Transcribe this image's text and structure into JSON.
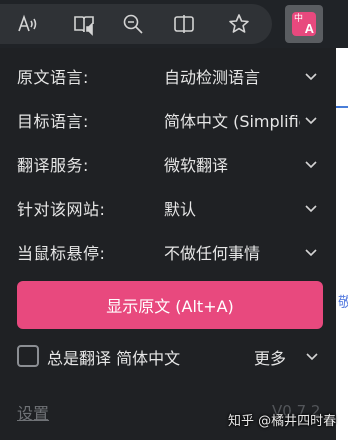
{
  "toolbar": {
    "buttons": [
      {
        "icon": "read-aloud-icon"
      },
      {
        "icon": "immersive-reader-icon"
      },
      {
        "icon": "zoom-out-icon"
      },
      {
        "icon": "split-screen-icon"
      },
      {
        "icon": "favorite-star-icon"
      }
    ],
    "extension": {
      "icon": "translate-extension-icon",
      "zh": "中",
      "en": "A",
      "color": "#e8497e"
    }
  },
  "popup": {
    "rows": [
      {
        "label": "原文语言:",
        "value": "自动检测语言"
      },
      {
        "label": "目标语言:",
        "value": "简体中文 (Simplified Chinese)"
      },
      {
        "label": "翻译服务:",
        "value": "微软翻译"
      },
      {
        "label": "针对该网站:",
        "value": "默认"
      },
      {
        "label": "当鼠标悬停:",
        "value": "不做任何事情"
      }
    ],
    "main_button": "显示原文 (Alt+A)",
    "always_translate": {
      "checked": false,
      "label": "总是翻译 简体中文"
    },
    "more": "更多",
    "settings": "设置",
    "version": "V0.7.2"
  },
  "page": {
    "side_char": "敬"
  },
  "watermark": "知乎 @橘井四时春",
  "colors": {
    "accent": "#e8497e",
    "popup_bg": "#1f2124",
    "text": "#e6e6e6"
  }
}
